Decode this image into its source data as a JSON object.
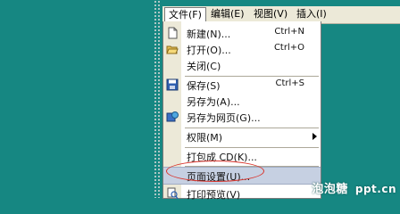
{
  "menubar": {
    "items": [
      {
        "label": "文件(F)",
        "active": true
      },
      {
        "label": "编辑(E)"
      },
      {
        "label": "视图(V)"
      },
      {
        "label": "插入(I)"
      }
    ]
  },
  "file_menu": {
    "items": [
      {
        "label": "新建(N)...",
        "shortcut": "Ctrl+N",
        "icon": "new-document-icon"
      },
      {
        "label": "打开(O)...",
        "shortcut": "Ctrl+O",
        "icon": "open-folder-icon"
      },
      {
        "label": "关闭(C)"
      },
      {
        "label": "保存(S)",
        "shortcut": "Ctrl+S",
        "icon": "save-disk-icon"
      },
      {
        "label": "另存为(A)..."
      },
      {
        "label": "另存为网页(G)...",
        "icon": "save-as-web-icon"
      },
      {
        "label": "权限(M)",
        "submenu": true
      },
      {
        "label": "打包成 CD(K)..."
      },
      {
        "label": "页面设置(U)...",
        "highlighted": true
      },
      {
        "label": "打印预览(V)",
        "icon": "print-preview-icon"
      }
    ]
  },
  "watermark": {
    "text_cn": "泡泡糖",
    "text_url": "ppt.cn"
  },
  "colors": {
    "desktop": "#168782",
    "highlight": "#c6d0e2",
    "annotation": "#d9342c"
  }
}
